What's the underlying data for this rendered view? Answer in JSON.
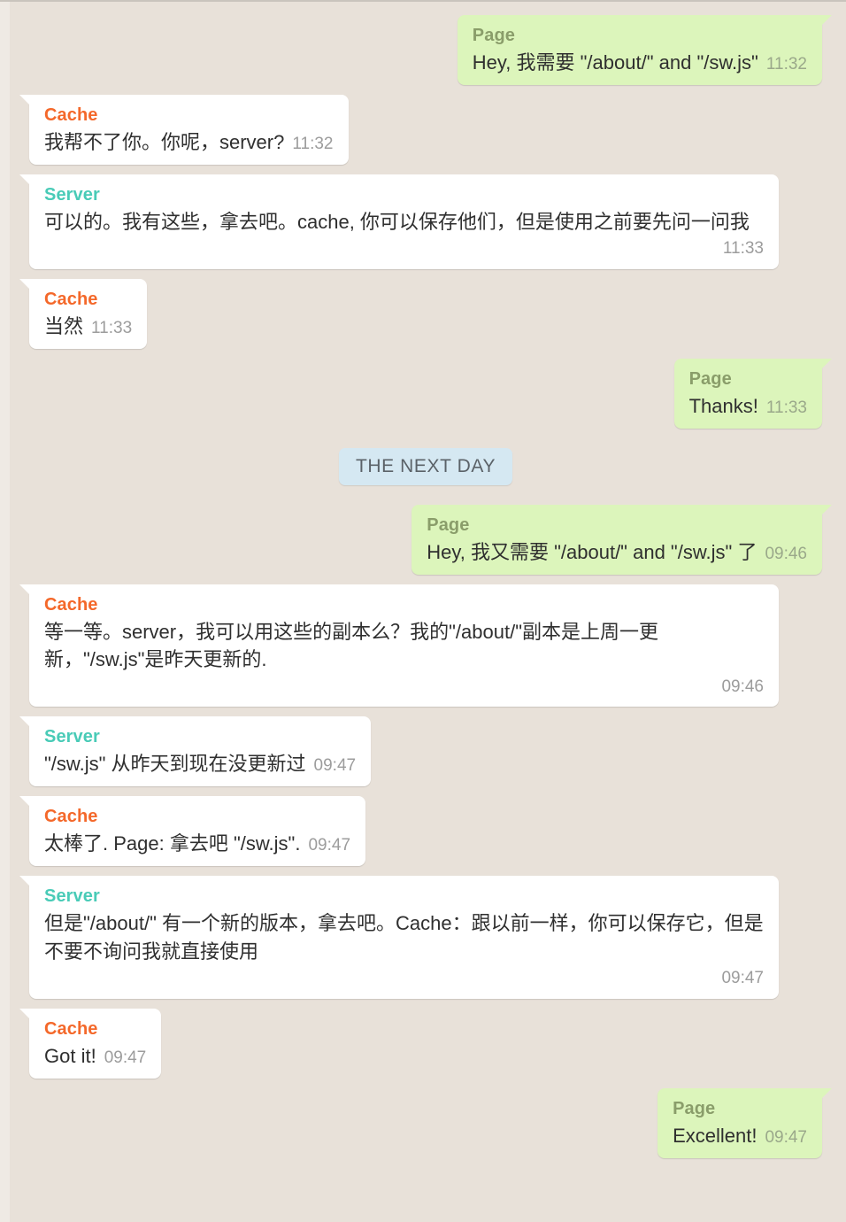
{
  "theme": {
    "background": "#e8e1d9",
    "incoming_bubble": "#ffffff",
    "outgoing_bubble": "#dcf5bb",
    "divider_bubble": "#d5e8f2",
    "cache_color": "#f4682a",
    "server_color": "#49cbb7",
    "page_color": "#8a9d6a",
    "time_color": "#9c9c9c"
  },
  "senders": {
    "page": "Page",
    "cache": "Cache",
    "server": "Server"
  },
  "divider": {
    "label": "THE NEXT DAY"
  },
  "messages": [
    {
      "sender": "Page",
      "side": "right",
      "text": "Hey, 我需要 \"/about/\" and \"/sw.js\"",
      "time": "11:32"
    },
    {
      "sender": "Cache",
      "side": "left",
      "text": "我帮不了你。你呢，server?",
      "time": "11:32"
    },
    {
      "sender": "Server",
      "side": "left",
      "text": "可以的。我有这些，拿去吧。cache, 你可以保存他们，但是使用之前要先问一问我",
      "time": "11:33"
    },
    {
      "sender": "Cache",
      "side": "left",
      "text": "当然",
      "time": "11:33"
    },
    {
      "sender": "Page",
      "side": "right",
      "text": "Thanks!",
      "time": "11:33"
    },
    {
      "sender": "Page",
      "side": "right",
      "text": "Hey, 我又需要 \"/about/\" and \"/sw.js\" 了",
      "time": "09:46"
    },
    {
      "sender": "Cache",
      "side": "left",
      "text": "等一等。server，我可以用这些的副本么？我的\"/about/\"副本是上周一更新，\"/sw.js\"是昨天更新的.",
      "time": "09:46"
    },
    {
      "sender": "Server",
      "side": "left",
      "text": "\"/sw.js\" 从昨天到现在没更新过",
      "time": "09:47"
    },
    {
      "sender": "Cache",
      "side": "left",
      "text": "太棒了. Page: 拿去吧 \"/sw.js\".",
      "time": "09:47"
    },
    {
      "sender": "Server",
      "side": "left",
      "text": "但是\"/about/\" 有一个新的版本，拿去吧。Cache：跟以前一样，你可以保存它，但是不要不询问我就直接使用",
      "time": "09:47"
    },
    {
      "sender": "Cache",
      "side": "left",
      "text": "Got it!",
      "time": "09:47"
    },
    {
      "sender": "Page",
      "side": "right",
      "text": "Excellent!",
      "time": "09:47"
    }
  ]
}
